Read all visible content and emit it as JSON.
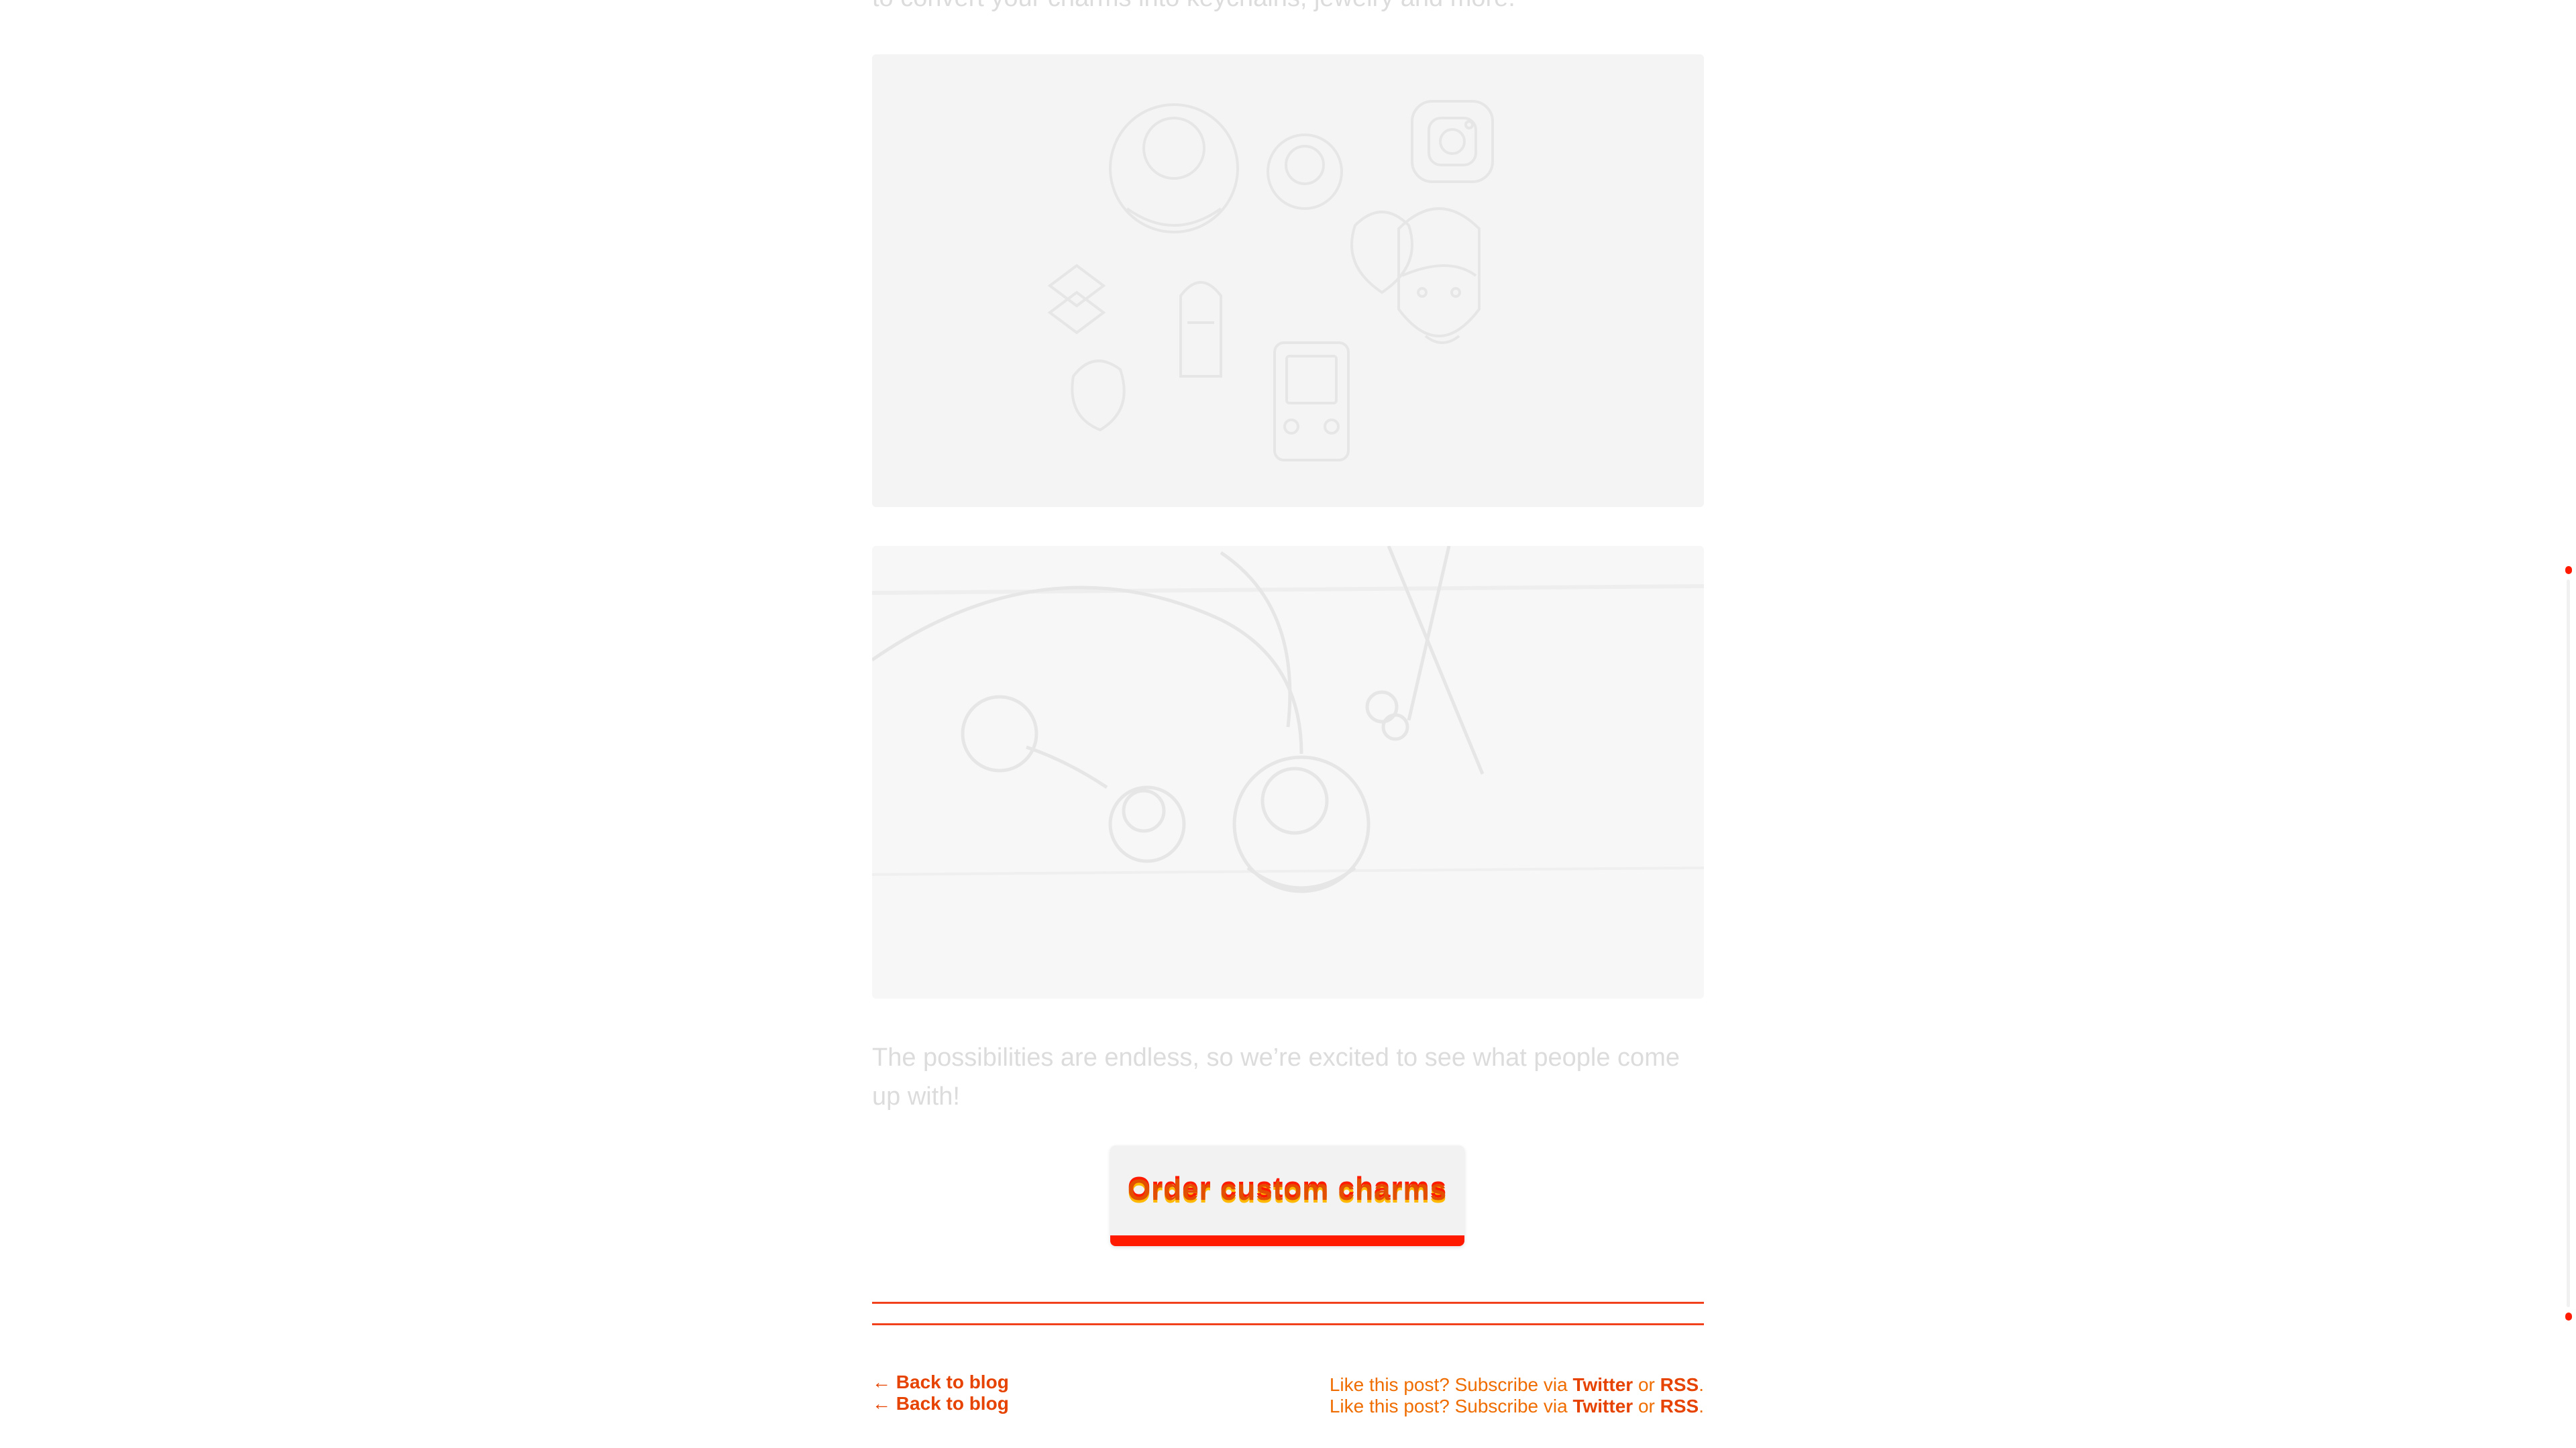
{
  "article": {
    "intro_tail": "to convert your charms into keychains, jewelry and more.",
    "images": [
      {
        "name": "charms-collection-image",
        "icon": "acrylic-charms-set-icon"
      },
      {
        "name": "keychain-necklace-photo",
        "icon": "keychain-photo-icon"
      }
    ],
    "closing": "The possibilities are endless, so we’re excited to see what people come up with!",
    "cta_label": "Order custom charms"
  },
  "footer": {
    "back_label": "← Back to blog",
    "subscribe_prefix": "Like this post? Subscribe via ",
    "twitter": "Twitter",
    "or": " or ",
    "rss": "RSS",
    "period": "."
  },
  "colors": {
    "accent_red": "#ff1a00",
    "accent_orange": "#e64200",
    "muted_text": "#dcdcdc"
  }
}
